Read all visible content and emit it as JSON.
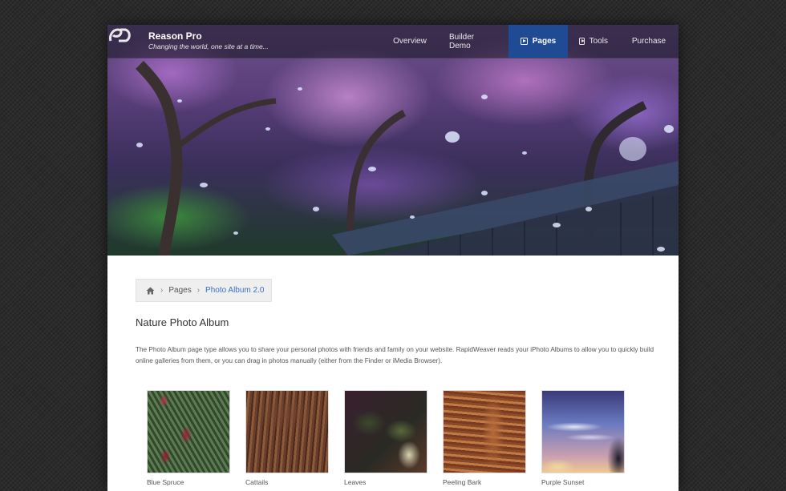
{
  "header": {
    "title": "Reason Pro",
    "tagline": "Changing the world, one site at a time..."
  },
  "nav": {
    "items": [
      {
        "label": "Overview",
        "icon": null,
        "active": false
      },
      {
        "label": "Builder Demo",
        "icon": null,
        "active": false
      },
      {
        "label": "Pages",
        "icon": "play-box-icon",
        "active": true
      },
      {
        "label": "Tools",
        "icon": "play-box-icon",
        "active": false
      },
      {
        "label": "Purchase",
        "icon": null,
        "active": false
      }
    ]
  },
  "colors": {
    "accent": "#1f4a94",
    "link": "#3c70c0"
  },
  "breadcrumb": {
    "home_icon": "home-icon",
    "items": [
      "Pages",
      "Photo Album 2.0"
    ]
  },
  "page": {
    "title": "Nature Photo Album",
    "intro": "The Photo Album page type allows you to share your personal photos with friends and family on your website. RapidWeaver reads your iPhoto Albums to allow you to quickly build online galleries from them, or you can drag in photos manually (either from the Finder or iMedia Browser)."
  },
  "gallery": {
    "items": [
      {
        "caption": "Blue Spruce"
      },
      {
        "caption": "Cattails"
      },
      {
        "caption": "Leaves"
      },
      {
        "caption": "Peeling Bark"
      },
      {
        "caption": "Purple Sunset"
      }
    ]
  }
}
